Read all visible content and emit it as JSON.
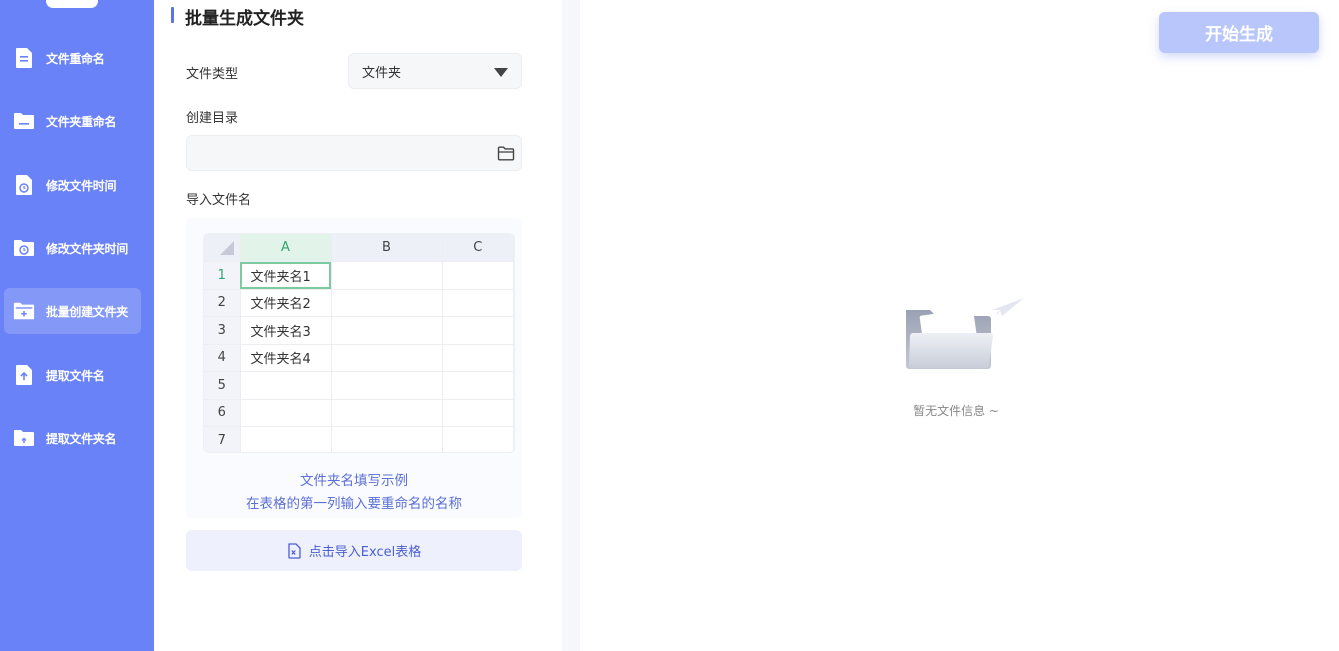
{
  "sidebar": {
    "items": [
      {
        "label": "文件重命名",
        "icon": "file-icon"
      },
      {
        "label": "文件夹重命名",
        "icon": "folder-icon"
      },
      {
        "label": "修改文件时间",
        "icon": "file-clock-icon"
      },
      {
        "label": "修改文件夹时间",
        "icon": "folder-clock-icon"
      },
      {
        "label": "批量创建文件夹",
        "icon": "folder-add-icon",
        "active": true
      },
      {
        "label": "提取文件名",
        "icon": "file-extract-icon"
      },
      {
        "label": "提取文件夹名",
        "icon": "folder-extract-icon"
      }
    ]
  },
  "panel": {
    "title": "批量生成文件夹",
    "file_type_label": "文件类型",
    "file_type_value": "文件夹",
    "dir_label": "创建目录",
    "dir_value": "",
    "import_label": "导入文件名",
    "sheet": {
      "columns": [
        "A",
        "B",
        "C"
      ],
      "rows": [
        {
          "num": "1",
          "a": "文件夹名1"
        },
        {
          "num": "2",
          "a": "文件夹名2"
        },
        {
          "num": "3",
          "a": "文件夹名3"
        },
        {
          "num": "4",
          "a": "文件夹名4"
        },
        {
          "num": "5",
          "a": ""
        },
        {
          "num": "6",
          "a": ""
        },
        {
          "num": "7",
          "a": ""
        }
      ]
    },
    "hint_line1": "文件夹名填写示例",
    "hint_line2": "在表格的第一列输入要重命名的名称",
    "import_button": "点击导入Excel表格"
  },
  "right": {
    "start_button": "开始生成",
    "empty_text": "暂无文件信息 ~"
  },
  "colors": {
    "sidebar_bg": "#6a82f7",
    "accent": "#5b72f3",
    "start_button_bg": "#b9c6fb"
  }
}
